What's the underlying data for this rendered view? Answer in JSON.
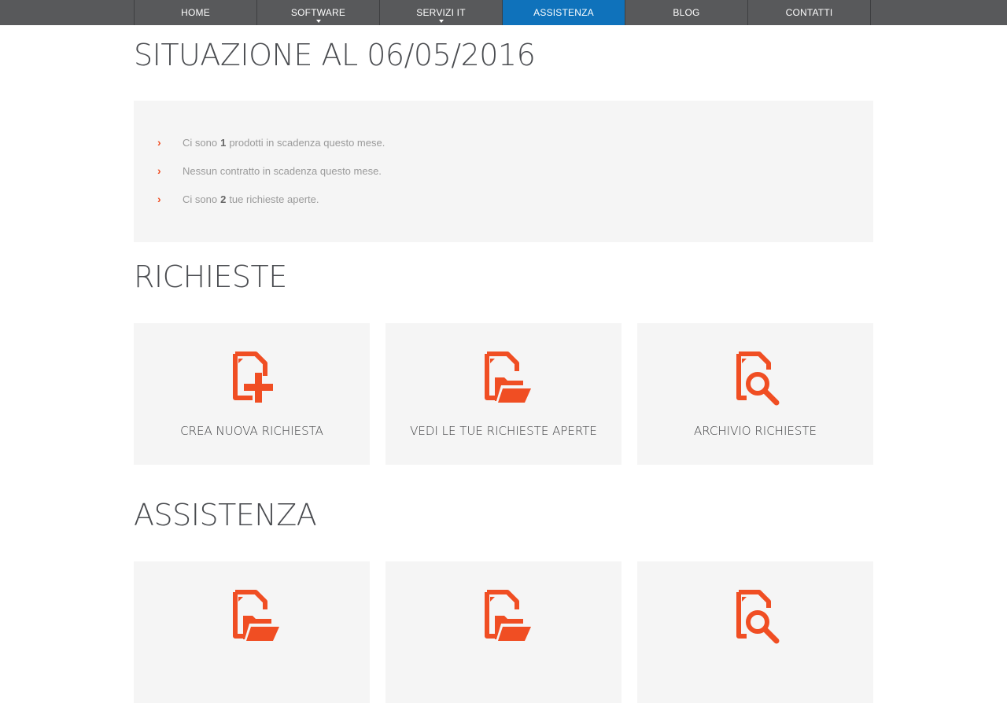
{
  "nav": {
    "items": [
      {
        "label": "HOME",
        "has_caret": false,
        "active": false
      },
      {
        "label": "SOFTWARE",
        "has_caret": true,
        "active": false
      },
      {
        "label": "SERVIZI IT",
        "has_caret": true,
        "active": false
      },
      {
        "label": "ASSISTENZA",
        "has_caret": false,
        "active": true
      },
      {
        "label": "BLOG",
        "has_caret": false,
        "active": false
      },
      {
        "label": "CONTATTI",
        "has_caret": false,
        "active": false
      }
    ],
    "bar_color": "#58595b",
    "active_color": "#0f72bb"
  },
  "page_title": "SITUAZIONE AL 06/05/2016",
  "status": {
    "items": [
      {
        "before": "Ci sono",
        "count": "1",
        "after": "prodotti in scadenza questo mese."
      },
      {
        "before": "Nessun contratto in scadenza questo mese.",
        "count": "",
        "after": ""
      },
      {
        "before": "Ci sono",
        "count": "2",
        "after": "tue richieste aperte."
      }
    ]
  },
  "richieste": {
    "title": "RICHIESTE",
    "cards": [
      {
        "label": "CREA NUOVA RICHIESTA",
        "icon": "file-plus-icon"
      },
      {
        "label": "VEDI LE TUE RICHIESTE APERTE",
        "icon": "file-folder-icon"
      },
      {
        "label": "ARCHIVIO RICHIESTE",
        "icon": "file-search-icon"
      }
    ]
  },
  "assistenza": {
    "title": "ASSISTENZA",
    "cards": [
      {
        "label": "",
        "icon": "file-folder-icon"
      },
      {
        "label": "",
        "icon": "file-folder-icon"
      },
      {
        "label": "",
        "icon": "file-search-icon"
      }
    ]
  },
  "accent_color": "#f04e23"
}
